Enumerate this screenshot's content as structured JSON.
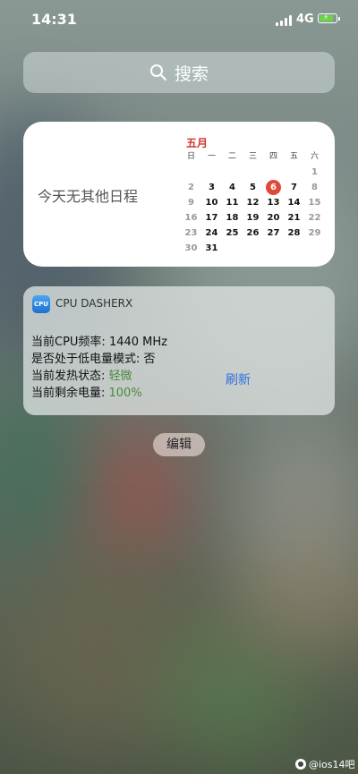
{
  "status_bar": {
    "time": "14:31",
    "network": "4G"
  },
  "search": {
    "label": "搜索"
  },
  "calendar_widget": {
    "no_events": "今天无其他日程",
    "month": "五月",
    "weekdays": [
      "日",
      "一",
      "二",
      "三",
      "四",
      "五",
      "六"
    ],
    "today": "6",
    "weeks": [
      [
        "",
        "",
        "",
        "",
        "",
        "",
        "1"
      ],
      [
        "2",
        "3",
        "4",
        "5",
        "6",
        "7",
        "8"
      ],
      [
        "9",
        "10",
        "11",
        "12",
        "13",
        "14",
        "15"
      ],
      [
        "16",
        "17",
        "18",
        "19",
        "20",
        "21",
        "22"
      ],
      [
        "23",
        "24",
        "25",
        "26",
        "27",
        "28",
        "29"
      ],
      [
        "30",
        "31",
        "",
        "",
        "",
        "",
        ""
      ]
    ]
  },
  "cpu_widget": {
    "app_icon_text": "CPU",
    "app_name": "CPU DASHERX",
    "freq_label": "当前CPU频率: ",
    "freq_value": "1440 MHz",
    "lowpower_label": "是否处于低电量模式: ",
    "lowpower_value": "否",
    "thermal_label": "当前发热状态: ",
    "thermal_value": "轻微",
    "battery_label": "当前剩余电量: ",
    "battery_value": "100%",
    "refresh": "刷新"
  },
  "edit_button": {
    "label": "编辑"
  },
  "watermark": {
    "text": "@ios14吧"
  }
}
